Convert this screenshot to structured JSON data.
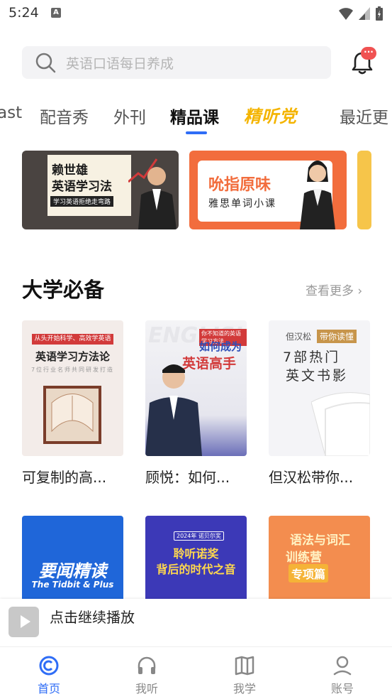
{
  "status_bar": {
    "time": "5:24",
    "notif_letter": "A"
  },
  "search": {
    "placeholder": "英语口语每日养成"
  },
  "notifications": {
    "badge": "···"
  },
  "tabs": [
    {
      "label": "ast",
      "active": false
    },
    {
      "label": "配音秀",
      "active": false
    },
    {
      "label": "外刊",
      "active": false
    },
    {
      "label": "精品课",
      "active": true
    },
    {
      "label": "精听党",
      "active": false
    },
    {
      "label": "最近更",
      "active": false
    }
  ],
  "banners": [
    {
      "title_line1": "赖世雄",
      "title_line2": "英语学习法",
      "tagline": "学习英语拒绝走弯路"
    },
    {
      "title": "吮指原味",
      "subtitle": "雅思单词小课"
    }
  ],
  "section": {
    "title": "大学必备",
    "more": "查看更多 ›"
  },
  "books": [
    {
      "name": "可复制的高...",
      "cover_top": "从头开始科学、高效学英语",
      "cover_title": "英语学习方法论",
      "cover_sub": "7位行业名师共同研发打造"
    },
    {
      "name": "顾悦：如何...",
      "cover_bg_word": "ENGLISH",
      "cover_tag": "你不知道的英语学习方法",
      "cover_line1": "如何成为",
      "cover_line2": "英语高手"
    },
    {
      "name": "但汉松带你...",
      "cover_head": "但汉松",
      "cover_badge": "带你读懂",
      "cover_line1": "7部热门",
      "cover_line2": "英文书影"
    },
    {
      "cover_title": "要闻精读",
      "cover_sub": "The Tidbit & Plus"
    },
    {
      "cover_tag": "2024年 诺贝尔奖",
      "cover_line1": "聆听诺奖",
      "cover_line2": "背后的时代之音"
    },
    {
      "cover_line1": "语法与词汇",
      "cover_line2": "训练营",
      "cover_line3": "专项篇"
    }
  ],
  "player": {
    "label": "点击继续播放"
  },
  "bottom_nav": [
    {
      "label": "首页",
      "active": true,
      "icon": "home-icon"
    },
    {
      "label": "我听",
      "active": false,
      "icon": "headphones-icon"
    },
    {
      "label": "我学",
      "active": false,
      "icon": "book-icon"
    },
    {
      "label": "账号",
      "active": false,
      "icon": "user-icon"
    }
  ],
  "colors": {
    "accent": "#2f6df6",
    "highlight_tab": "#f4b400",
    "badge": "#f05252"
  }
}
